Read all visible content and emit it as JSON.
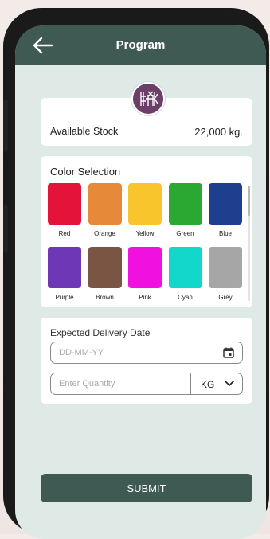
{
  "header": {
    "title": "Program",
    "back_icon": "arrow-left-icon"
  },
  "logo": {
    "icon": "brand-logo-icon",
    "color": "#6c3f6a"
  },
  "stock": {
    "label": "Available Stock",
    "value": "22,000 kg."
  },
  "color_selection": {
    "title": "Color Selection",
    "colors": [
      {
        "name": "Red",
        "hex": "#e3133a"
      },
      {
        "name": "Orange",
        "hex": "#e68a3a"
      },
      {
        "name": "Yellow",
        "hex": "#f8c62c"
      },
      {
        "name": "Green",
        "hex": "#2aa832"
      },
      {
        "name": "Blue",
        "hex": "#1e3f8e"
      },
      {
        "name": "Purple",
        "hex": "#6d37b6"
      },
      {
        "name": "Brown",
        "hex": "#7b5544"
      },
      {
        "name": "Pink",
        "hex": "#f011e0"
      },
      {
        "name": "Cyan",
        "hex": "#14d7cc"
      },
      {
        "name": "Grey",
        "hex": "#a6a6a6"
      }
    ]
  },
  "delivery": {
    "label": "Expected Delivery Date",
    "date_placeholder": "DD-MM-YY",
    "calendar_icon": "calendar-icon",
    "quantity_placeholder": "Enter Quantity",
    "unit": "KG",
    "unit_icon": "chevron-down-icon"
  },
  "submit_label": "SUBMIT",
  "theme": {
    "primary": "#3f5a53",
    "background": "#dfe9e6"
  }
}
